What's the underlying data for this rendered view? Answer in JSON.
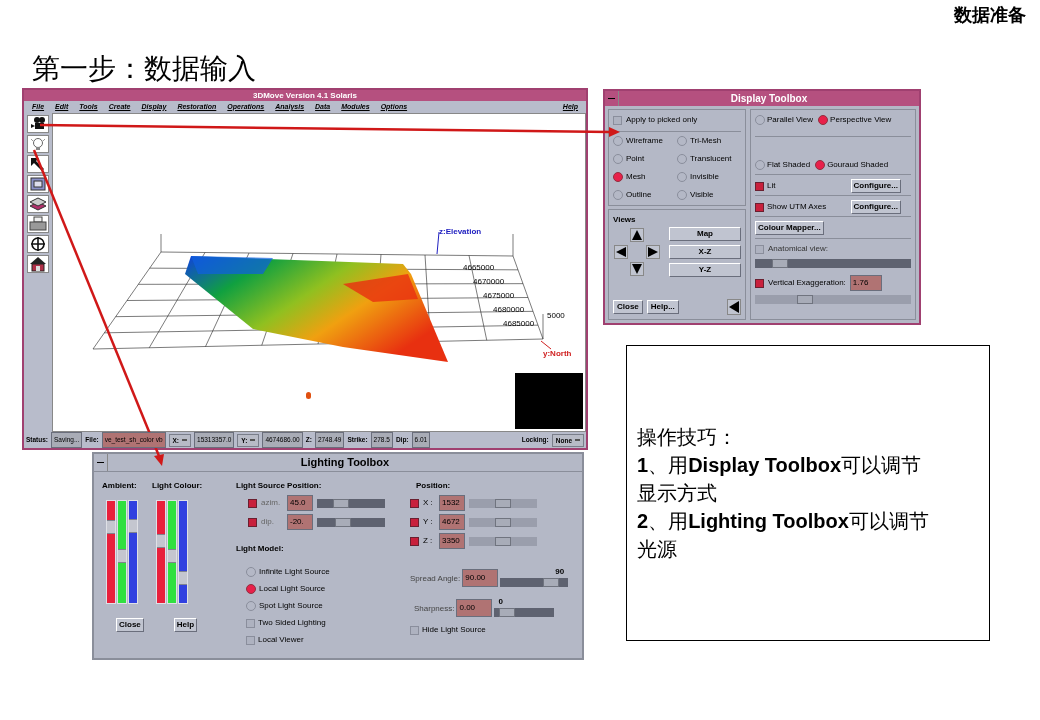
{
  "corner_title": "数据准备",
  "heading": "第一步：数据输入",
  "main_window": {
    "title": "3DMove Version 4.1 Solaris",
    "menu": [
      "File",
      "Edit",
      "Tools",
      "Create",
      "Display",
      "Restoration",
      "Operations",
      "Analysis",
      "Data",
      "Modules",
      "Options"
    ],
    "menu_right": "Help",
    "tools": [
      {
        "kind": "camera"
      },
      {
        "kind": "bulb"
      },
      {
        "kind": "pointer"
      },
      {
        "kind": "window"
      },
      {
        "kind": "layers"
      },
      {
        "kind": "printer"
      },
      {
        "kind": "crosshair"
      },
      {
        "kind": "house"
      }
    ],
    "plot": {
      "z_axis": "z:Elevation",
      "y_axis": "y:North",
      "y_ticks": [
        "4665000",
        "4670000",
        "4675000",
        "4680000",
        "4685000"
      ],
      "z_tick": "5000"
    },
    "status_bar": [
      {
        "kind": "field",
        "label": "Status:",
        "value": "Saving..."
      },
      {
        "kind": "file_field",
        "label": "File:",
        "value": "ve_test_sh_color vb"
      },
      {
        "kind": "dropdown",
        "label": "X:"
      },
      {
        "kind": "value",
        "value": "15313357.0"
      },
      {
        "kind": "dropdown",
        "label": "Y:"
      },
      {
        "kind": "value",
        "value": "4674686.00"
      },
      {
        "kind": "field",
        "label": "Z:",
        "value": "2748.49"
      },
      {
        "kind": "field",
        "label": "Strike:",
        "value": "278.5"
      },
      {
        "kind": "field",
        "label": "Dip:",
        "value": "6.01"
      },
      {
        "kind": "spacer"
      },
      {
        "kind": "dropdown",
        "label": "Locking:",
        "value": "None"
      }
    ]
  },
  "display_toolbox": {
    "title": "Display Toolbox",
    "apply_picked": {
      "label": "Apply to picked only",
      "checked": false
    },
    "render_modes": [
      {
        "label": "Wireframe",
        "selected": false
      },
      {
        "label": "Tri-Mesh",
        "selected": false
      },
      {
        "label": "Point",
        "selected": false
      },
      {
        "label": "Translucent",
        "selected": false
      },
      {
        "label": "Mesh",
        "selected": true
      },
      {
        "label": "Invisible",
        "selected": false
      },
      {
        "label": "Outline",
        "selected": false
      },
      {
        "label": "Visible",
        "selected": false
      }
    ],
    "views_label": "Views",
    "view_buttons": [
      "Map",
      "X-Z",
      "Y-Z"
    ],
    "bottom_buttons": [
      "Close",
      "Help..."
    ],
    "projection": [
      {
        "label": "Parallel View",
        "selected": false
      },
      {
        "label": "Perspective View",
        "selected": true
      }
    ],
    "shading": [
      {
        "label": "Flat Shaded",
        "selected": false
      },
      {
        "label": "Gouraud Shaded",
        "selected": true
      }
    ],
    "options": [
      {
        "label": "Lit",
        "checked": true,
        "button": "Configure..."
      },
      {
        "label": "Show UTM Axes",
        "checked": true,
        "button": "Configure..."
      }
    ],
    "colour_mapper": "Colour Mapper...",
    "anatomical": {
      "label": "Anatomical view:",
      "checked": false,
      "level": 0.12
    },
    "exaggeration": {
      "label": "Vertical Exaggeration:",
      "checked": true,
      "value": "1.76",
      "level": 0.3
    }
  },
  "lighting_toolbox": {
    "title": "Lighting Toolbox",
    "ambient": {
      "label": "Ambient:",
      "channels": [
        {
          "color": "#e8203c",
          "level": 0.78
        },
        {
          "color": "#30e040",
          "level": 0.45
        },
        {
          "color": "#3040e0",
          "level": 0.8
        }
      ]
    },
    "light_colour": {
      "label": "Light Colour:",
      "channels": [
        {
          "color": "#e8203c",
          "level": 0.62
        },
        {
          "color": "#30e040",
          "level": 0.45
        },
        {
          "color": "#3040e0",
          "level": 0.2
        }
      ]
    },
    "buttons": [
      "Close",
      "Help"
    ],
    "source_position": {
      "label": "Light Source Position:",
      "rows": [
        {
          "label": "azim.",
          "checked": true,
          "value": "45.0",
          "level": 0.3
        },
        {
          "label": "dip.",
          "checked": true,
          "value": "-20.",
          "level": 0.35
        }
      ]
    },
    "model_label": "Light Model:",
    "models": [
      {
        "label": "Infinite Light Source",
        "selected": false
      },
      {
        "label": "Local Light Source",
        "selected": true
      },
      {
        "label": "Spot Light Source",
        "selected": false
      }
    ],
    "model_options": [
      {
        "label": "Two Sided Lighting",
        "checked": false
      },
      {
        "label": "Local Viewer",
        "checked": false
      }
    ],
    "position": {
      "label": "Position:",
      "rows": [
        {
          "label": "X :",
          "checked": true,
          "value": "1532",
          "level": 0.5
        },
        {
          "label": "Y :",
          "checked": true,
          "value": "4672",
          "level": 0.5
        },
        {
          "label": "Z :",
          "checked": true,
          "value": "3350",
          "level": 0.5
        }
      ]
    },
    "spread": {
      "label": "Spread Angle:",
      "value": "90.00",
      "reading": "90",
      "level": 0.82
    },
    "sharpness": {
      "label": "Sharpness:",
      "value": "0.00",
      "reading": "0",
      "level": 0.1
    },
    "hide_source": {
      "label": "Hide Light Source",
      "checked": false
    }
  },
  "tips": {
    "title": "操作技巧：",
    "lines": [
      "**1**、用**Display Toolbox**可以调节显示方式",
      "**2**、用**Lighting Toolbox**可以调节光源"
    ]
  }
}
